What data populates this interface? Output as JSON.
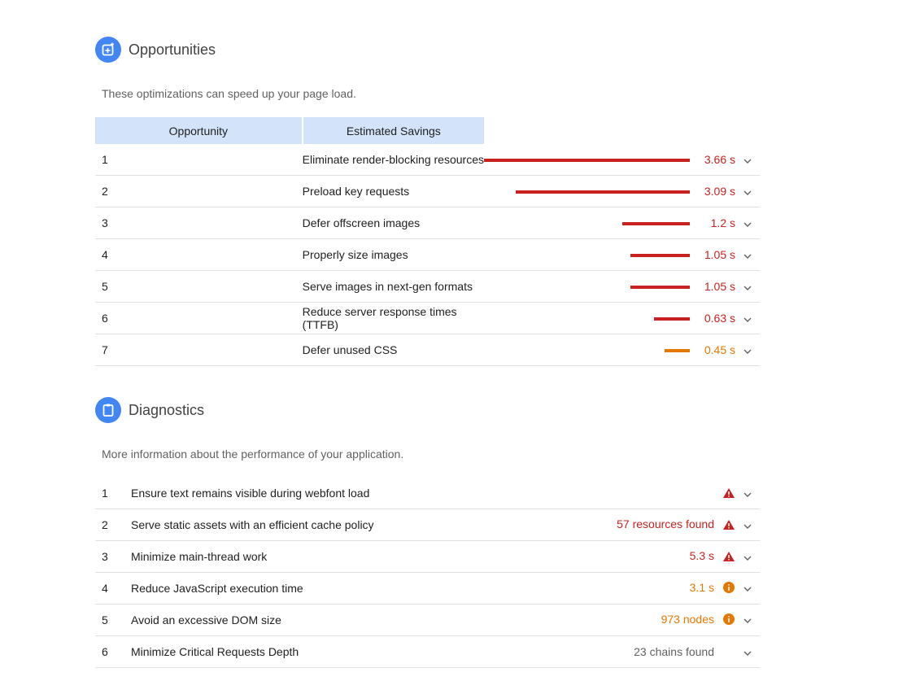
{
  "opportunities": {
    "title": "Opportunities",
    "icon": "opportunity-icon",
    "description": "These optimizations can speed up your page load.",
    "headers": [
      "Opportunity",
      "Estimated Savings"
    ],
    "max_savings_s": 3.66,
    "rows": [
      {
        "n": "1",
        "label": "Eliminate render-blocking resources",
        "value": "3.66 s",
        "savings": 3.66,
        "color": "#c7221f"
      },
      {
        "n": "2",
        "label": "Preload key requests",
        "value": "3.09 s",
        "savings": 3.09,
        "color": "#c7221f"
      },
      {
        "n": "3",
        "label": "Defer offscreen images",
        "value": "1.2 s",
        "savings": 1.2,
        "color": "#c7221f"
      },
      {
        "n": "4",
        "label": "Properly size images",
        "value": "1.05 s",
        "savings": 1.05,
        "color": "#c7221f"
      },
      {
        "n": "5",
        "label": "Serve images in next-gen formats",
        "value": "1.05 s",
        "savings": 1.05,
        "color": "#c7221f"
      },
      {
        "n": "6",
        "label": "Reduce server response times (TTFB)",
        "value": "0.63 s",
        "savings": 0.63,
        "color": "#c7221f"
      },
      {
        "n": "7",
        "label": "Defer unused CSS",
        "value": "0.45 s",
        "savings": 0.45,
        "color": "#e67700"
      }
    ]
  },
  "diagnostics": {
    "title": "Diagnostics",
    "icon": "clipboard-icon",
    "description": "More information about the performance of your application.",
    "rows": [
      {
        "n": "1",
        "label": "Ensure text remains visible during webfont load",
        "value": "",
        "status": "warning-triangle",
        "color": "#c7221f"
      },
      {
        "n": "2",
        "label": "Serve static assets with an efficient cache policy",
        "value": "57 resources found",
        "status": "warning-triangle",
        "color": "#c7221f"
      },
      {
        "n": "3",
        "label": "Minimize main-thread work",
        "value": "5.3 s",
        "status": "warning-triangle",
        "color": "#c7221f"
      },
      {
        "n": "4",
        "label": "Reduce JavaScript execution time",
        "value": "3.1 s",
        "status": "info-circle",
        "color": "#e67700"
      },
      {
        "n": "5",
        "label": "Avoid an excessive DOM size",
        "value": "973 nodes",
        "status": "info-circle",
        "color": "#e67700"
      },
      {
        "n": "6",
        "label": "Minimize Critical Requests Depth",
        "value": "23 chains found",
        "status": "",
        "color": "#616161"
      }
    ]
  }
}
